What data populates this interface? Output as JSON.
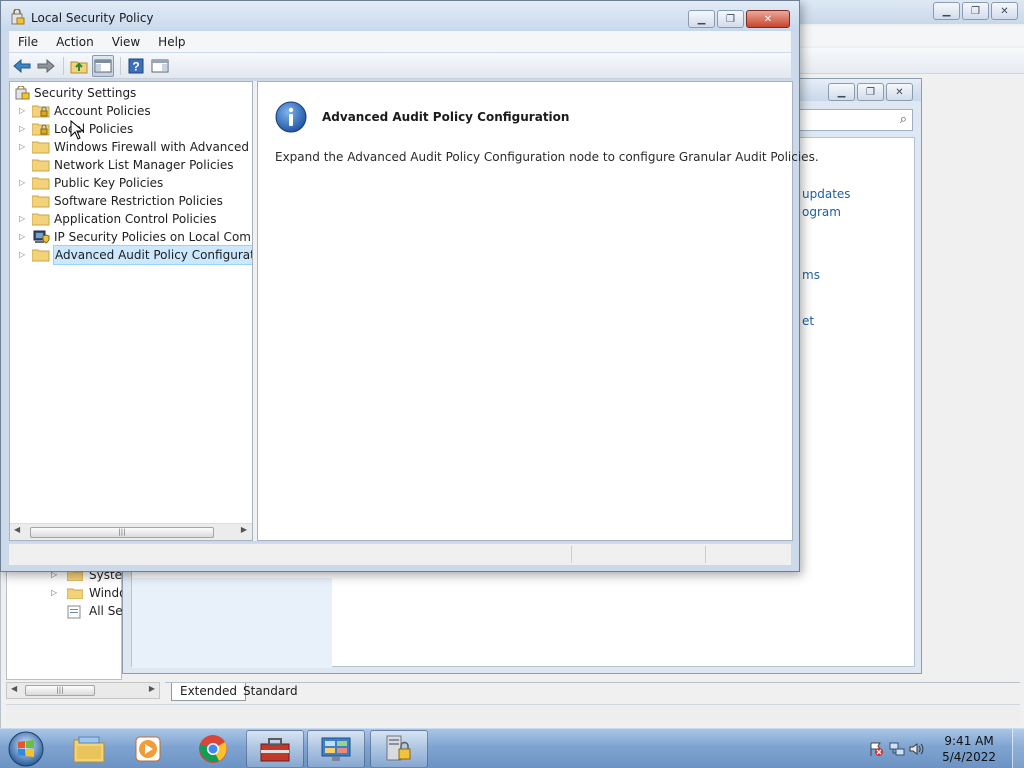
{
  "background_window": {
    "tree_items": [
      {
        "label": "System"
      },
      {
        "label": "Windo"
      },
      {
        "label": "All Sett"
      }
    ],
    "tabs": [
      {
        "label": "Extended",
        "active": true
      },
      {
        "label": "Standard",
        "active": false
      }
    ]
  },
  "control_panel": {
    "links": [
      "updates",
      "ogram",
      "ms",
      "et"
    ]
  },
  "lsp_window": {
    "title": "Local Security Policy",
    "menu": [
      "File",
      "Action",
      "View",
      "Help"
    ],
    "toolbar_icons": [
      "back-arrow-icon",
      "forward-arrow-icon",
      "up-folder-icon",
      "show-hide-tree-icon",
      "help-icon",
      "action-pane-icon"
    ],
    "tree": {
      "root": "Security Settings",
      "items": [
        {
          "label": "Account Policies",
          "expandable": true,
          "icon": "locked-folder"
        },
        {
          "label": "Local Policies",
          "expandable": true,
          "icon": "locked-folder"
        },
        {
          "label": "Windows Firewall with Advanced Secu",
          "expandable": true,
          "icon": "folder"
        },
        {
          "label": "Network List Manager Policies",
          "expandable": false,
          "icon": "folder"
        },
        {
          "label": "Public Key Policies",
          "expandable": true,
          "icon": "folder"
        },
        {
          "label": "Software Restriction Policies",
          "expandable": false,
          "icon": "folder"
        },
        {
          "label": "Application Control Policies",
          "expandable": true,
          "icon": "folder"
        },
        {
          "label": "IP Security Policies on Local Compute",
          "expandable": true,
          "icon": "computer-shield"
        },
        {
          "label": "Advanced Audit Policy Configuration",
          "expandable": true,
          "icon": "folder",
          "selected": true
        }
      ]
    },
    "detail": {
      "title": "Advanced Audit Policy Configuration",
      "text": "Expand the Advanced Audit Policy Configuration node to configure Granular Audit Policies."
    }
  },
  "taskbar": {
    "pinned": [
      "windows-explorer",
      "media-player",
      "chrome",
      "toolbox",
      "control-panel",
      "local-security-policy"
    ],
    "clock": {
      "time": "9:41 AM",
      "date": "5/4/2022"
    }
  },
  "colors": {
    "selection": "#cce8ff",
    "close_button": "#c7452d",
    "link": "#1f5ea8",
    "taskbar": "#7fa4d1"
  }
}
